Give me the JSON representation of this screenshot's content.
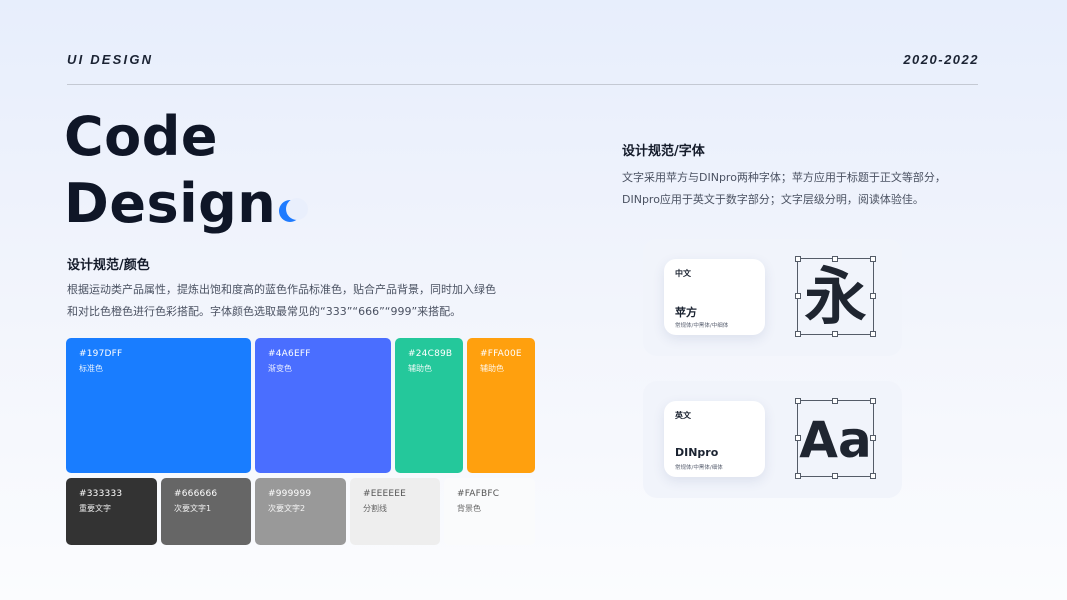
{
  "header": {
    "left": "UI  DESIGN",
    "right": "2020-2022"
  },
  "hero": {
    "line1": "Code",
    "line2": "Design"
  },
  "colors": {
    "title": "设计规范/颜色",
    "desc_line1": "根据运动类产品属性，提炼出饱和度高的蓝色作品标准色，贴合产品背景，同时加入绿色",
    "desc_line2": "和对比色橙色进行色彩搭配。字体颜色选取最常见的“333”“666”“999”来搭配。",
    "swatches": [
      {
        "code": "#197DFF",
        "name": "标准色",
        "hex": "#197DFF"
      },
      {
        "code": "#4A6EFF",
        "name": "渐变色",
        "hex": "#4A6EFF"
      },
      {
        "code": "#24C89B",
        "name": "辅助色",
        "hex": "#24C89B"
      },
      {
        "code": "#FFA00E",
        "name": "辅助色",
        "hex": "#FFA00E"
      },
      {
        "code": "#333333",
        "name": "重要文字",
        "hex": "#333333"
      },
      {
        "code": "#666666",
        "name": "次要文字1",
        "hex": "#666666"
      },
      {
        "code": "#999999",
        "name": "次要文字2",
        "hex": "#999999"
      },
      {
        "code": "#EEEEEE",
        "name": "分割线",
        "hex": "#EEEEEE"
      },
      {
        "code": "#FAFBFC",
        "name": "背景色",
        "hex": "#FAFBFC"
      }
    ]
  },
  "fonts": {
    "title": "设计规范/字体",
    "desc_line1": "文字采用苹方与DINpro两种字体；苹方应用于标题于正文等部分，",
    "desc_line2": "DINpro应用于英文于数字部分；文字层级分明，阅读体验佳。",
    "cards": [
      {
        "label": "中文",
        "font_name": "苹方",
        "weights": "常规体/中黑体/中细体",
        "sample": "永"
      },
      {
        "label": "英文",
        "font_name": "DINpro",
        "weights": "常规体/中黑体/细体",
        "sample": "Aa"
      }
    ]
  },
  "accent": "#1E7BFF"
}
